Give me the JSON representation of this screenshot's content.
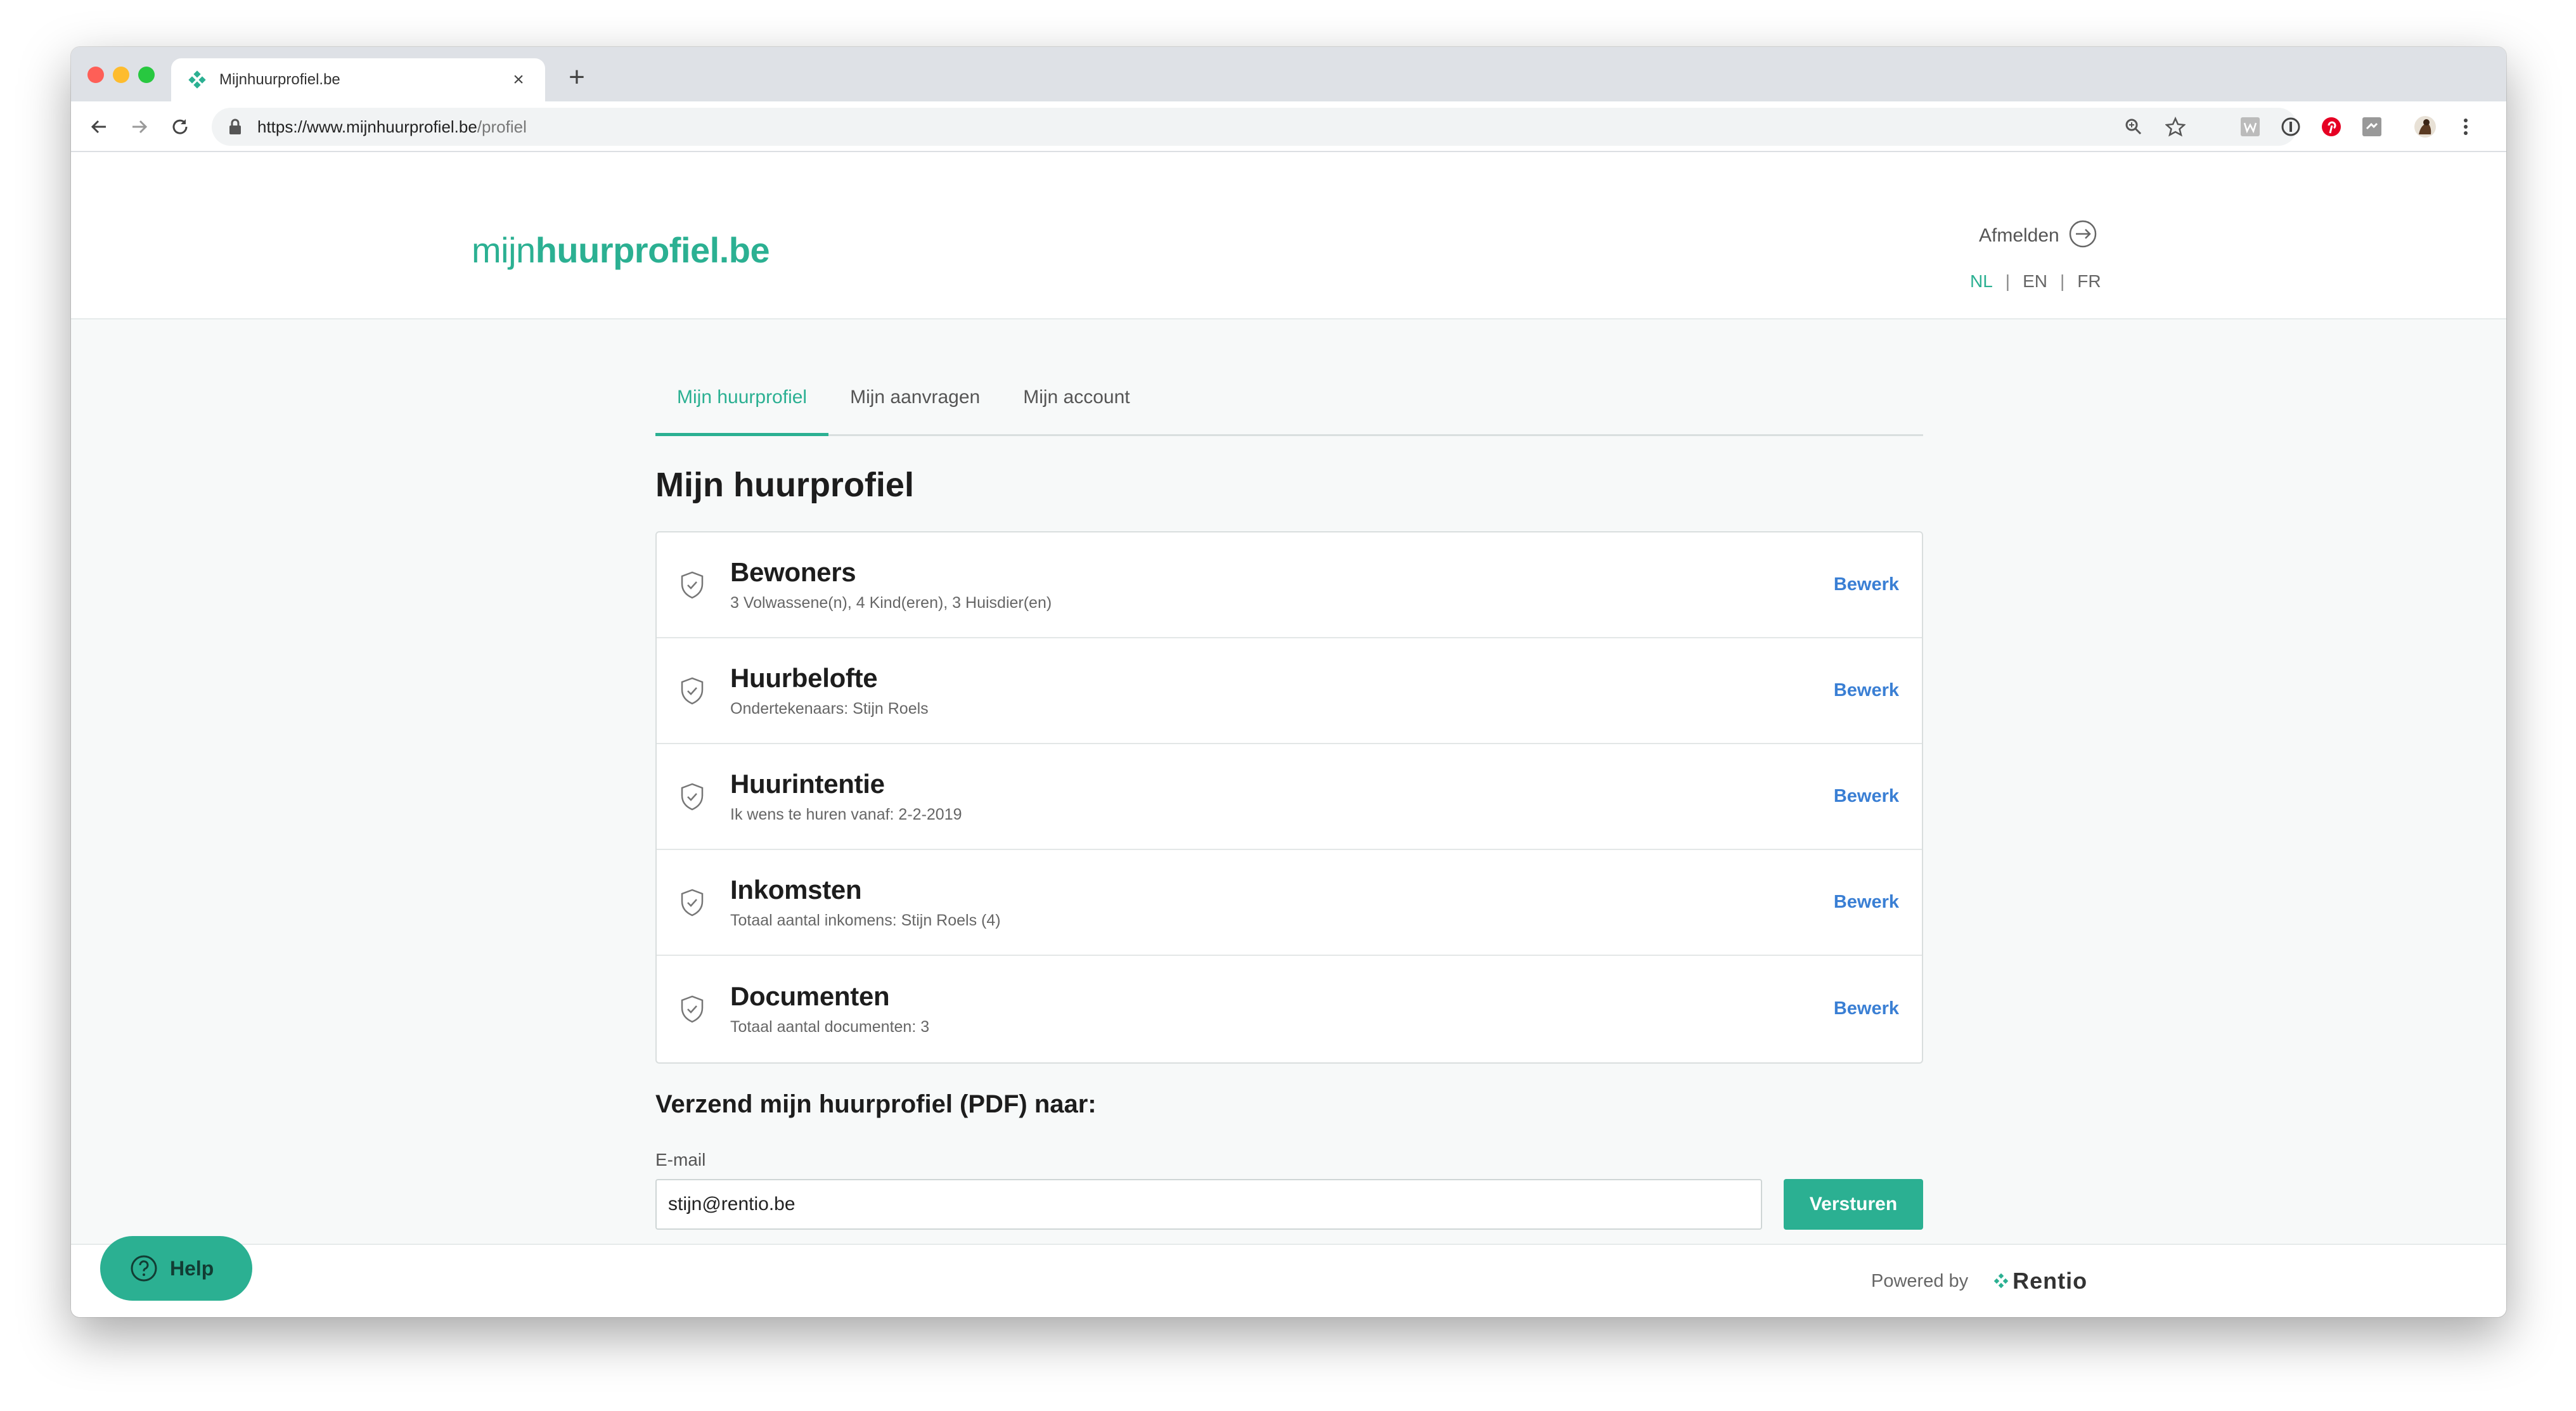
{
  "browser": {
    "tab_title": "Mijnhuurprofiel.be",
    "close_glyph": "×",
    "new_tab_glyph": "+",
    "url_host": "https://www.mijnhuurprofiel.be",
    "url_path": "/profiel"
  },
  "header": {
    "logo_light": "mijn",
    "logo_bold": "huurprofiel.be",
    "logout_label": "Afmelden",
    "languages": [
      {
        "label": "NL"
      },
      {
        "label": "EN"
      },
      {
        "label": "FR"
      }
    ],
    "lang_separator": "|"
  },
  "nav": {
    "tabs": [
      {
        "label": "Mijn huurprofiel"
      },
      {
        "label": "Mijn aanvragen"
      },
      {
        "label": "Mijn account"
      }
    ]
  },
  "main": {
    "page_title": "Mijn huurprofiel",
    "sections": [
      {
        "title": "Bewoners",
        "subtitle": "3 Volwassene(n), 4 Kind(eren), 3 Huisdier(en)",
        "action": "Bewerk"
      },
      {
        "title": "Huurbelofte",
        "subtitle": "Ondertekenaars: Stijn Roels",
        "action": "Bewerk"
      },
      {
        "title": "Huurintentie",
        "subtitle": "Ik wens te huren vanaf: 2-2-2019",
        "action": "Bewerk"
      },
      {
        "title": "Inkomsten",
        "subtitle": "Totaal aantal inkomens: Stijn Roels (4)",
        "action": "Bewerk"
      },
      {
        "title": "Documenten",
        "subtitle": "Totaal aantal documenten: 3",
        "action": "Bewerk"
      }
    ],
    "send": {
      "title": "Verzend mijn huurprofiel (PDF) naar:",
      "email_label": "E-mail",
      "email_value": "stijn@rentio.be",
      "button_label": "Versturen"
    }
  },
  "footer": {
    "help_label": "Help",
    "powered_by": "Powered by",
    "brand": "Rentio"
  },
  "colors": {
    "accent": "#2bb092",
    "link": "#3a7fd4",
    "background": "#f7f9f9"
  },
  "icons": [
    "favicon-icon",
    "back-icon",
    "forward-icon",
    "reload-icon",
    "lock-icon",
    "zoom-icon",
    "star-icon",
    "logout-icon",
    "shield-check-icon",
    "help-icon",
    "rentio-logo-icon"
  ]
}
